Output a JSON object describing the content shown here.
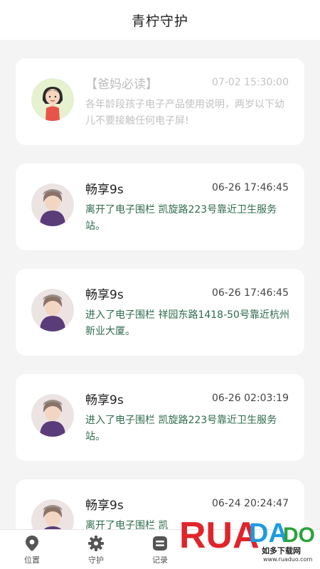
{
  "header": {
    "title": "青柠守护"
  },
  "feed": [
    {
      "name": "【爸妈必读】",
      "time": "07-02 15:30:00",
      "message": "各年龄段孩子电子产品使用说明，两岁以下幼儿不要接触任何电子屏!"
    },
    {
      "name": "畅享9s",
      "time": "06-26 17:46:45",
      "message": "离开了电子围栏 凯旋路223号靠近卫生服务站。"
    },
    {
      "name": "畅享9s",
      "time": "06-26 17:46:45",
      "message": "进入了电子围栏 祥园东路1418-50号靠近杭州新业大厦。"
    },
    {
      "name": "畅享9s",
      "time": "06-26 02:03:19",
      "message": "进入了电子围栏 凯旋路223号靠近卫生服务站。"
    },
    {
      "name": "畅享9s",
      "time": "06-24 20:24:47",
      "message": "离开了电子围栏 凯"
    }
  ],
  "tabbar": {
    "tabs": [
      {
        "label": "位置",
        "icon": "location-pin-icon"
      },
      {
        "label": "守护",
        "icon": "gear-icon"
      },
      {
        "label": "记录",
        "icon": "record-icon"
      }
    ]
  },
  "watermark": {
    "brand": "RUADADO",
    "tagline": "如多下载网",
    "url": "www.ruaduo.com"
  },
  "colors": {
    "message_green": "#2f6b4e",
    "notice_gray": "#c2c2c2",
    "background": "#f4f4f4"
  }
}
